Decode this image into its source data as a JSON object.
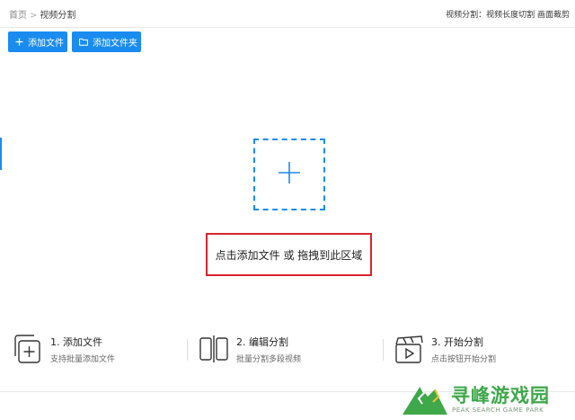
{
  "breadcrumb": {
    "home": "首页",
    "separator": ">",
    "current": "视频分割"
  },
  "header_hint": "视频分割：视频长度切割 画面裁剪",
  "toolbar": {
    "add_file_label": "添加文件",
    "add_folder_label": "添加文件夹"
  },
  "dropzone": {
    "text": "点击添加文件 或 拖拽到此区域"
  },
  "steps": [
    {
      "title": "1. 添加文件",
      "desc": "支持批量添加文件",
      "icon": "copy-add-icon"
    },
    {
      "title": "2. 编辑分割",
      "desc": "批量分割多段视频",
      "icon": "split-icon"
    },
    {
      "title": "3. 开始分割",
      "desc": "点击按钮开始分割",
      "icon": "clapperboard-icon"
    }
  ],
  "watermark": {
    "title": "寻峰游戏园",
    "subtitle": "PEAK SEARCH GAME PARK"
  },
  "colors": {
    "accent": "#1a8cf0",
    "highlight_border": "#d9242b",
    "watermark_green": "#3ea84a"
  }
}
